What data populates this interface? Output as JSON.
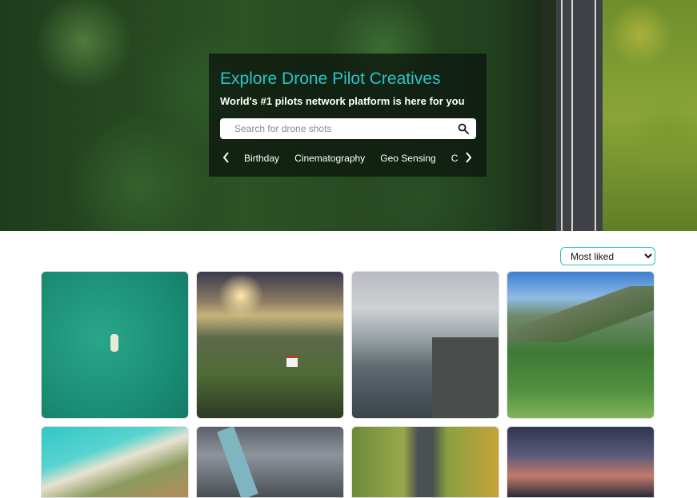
{
  "hero": {
    "title": "Explore Drone Pilot Creatives",
    "subtitle": "World's #1 pilots network platform is here for you"
  },
  "search": {
    "placeholder": "Search for drone shots",
    "value": ""
  },
  "categories": {
    "items": [
      "Birthday",
      "Cinematography",
      "Geo Sensing",
      "Construction"
    ]
  },
  "sort": {
    "selected": "Most liked"
  },
  "gallery": {
    "items": [
      {
        "subject": "boat on turquoise sea"
      },
      {
        "subject": "lighthouse on cliff at sunset"
      },
      {
        "subject": "person on cliff edge over fjord"
      },
      {
        "subject": "mountain village"
      },
      {
        "subject": "beach coastline"
      },
      {
        "subject": "tower seen from above"
      },
      {
        "subject": "road through autumn forest"
      },
      {
        "subject": "twilight city skyline"
      }
    ]
  },
  "colors": {
    "accent": "#29c6c9",
    "panel": "rgba(10,18,12,0.72)"
  },
  "icons": [
    "search-icon",
    "chevron-left-icon",
    "chevron-right-icon"
  ]
}
